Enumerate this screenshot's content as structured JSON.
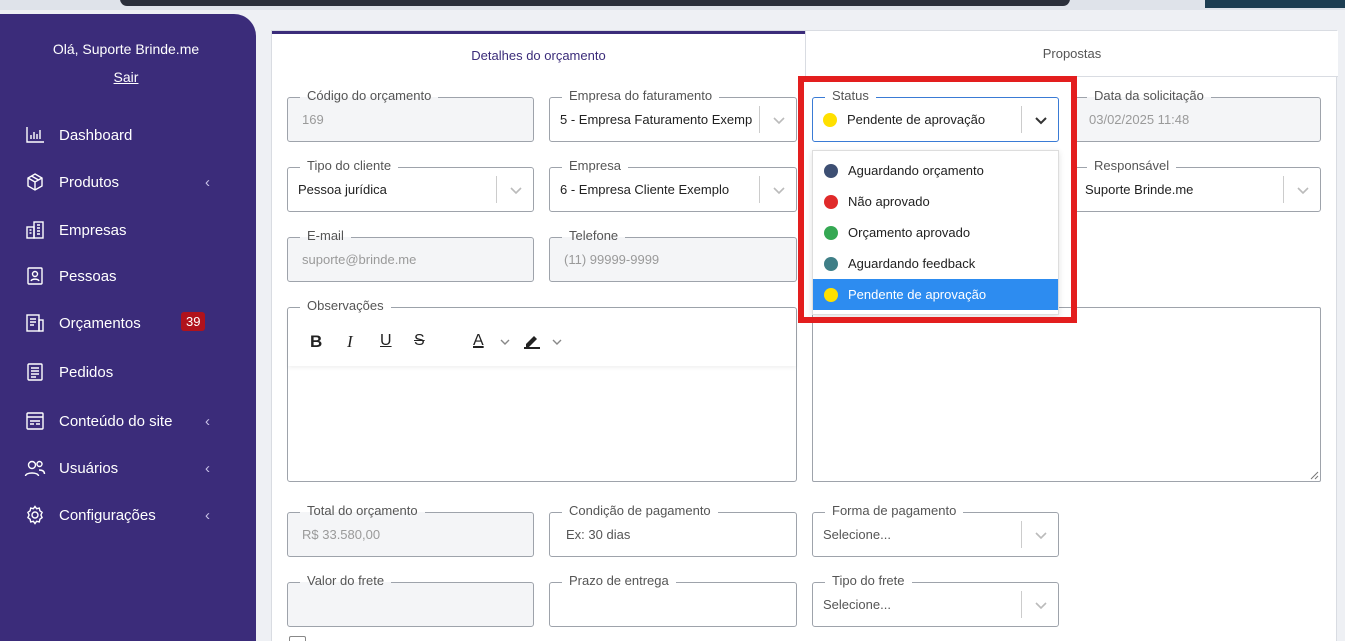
{
  "sidebar": {
    "greeting": "Olá, Suporte Brinde.me",
    "logout": "Sair",
    "items": [
      {
        "label": "Dashboard",
        "icon": "chart-icon"
      },
      {
        "label": "Produtos",
        "icon": "box-icon"
      },
      {
        "label": "Empresas",
        "icon": "building-icon"
      },
      {
        "label": "Pessoas",
        "icon": "person-card-icon"
      },
      {
        "label": "Orçamentos",
        "icon": "document-list-icon",
        "badge": "39"
      },
      {
        "label": "Pedidos",
        "icon": "document-icon"
      },
      {
        "label": "Conteúdo do site",
        "icon": "site-content-icon"
      },
      {
        "label": "Usuários",
        "icon": "users-icon"
      },
      {
        "label": "Configurações",
        "icon": "gear-icon"
      }
    ]
  },
  "tabs": {
    "details": "Detalhes do orçamento",
    "proposals": "Propostas"
  },
  "form": {
    "code": {
      "label": "Código do orçamento",
      "value": "169"
    },
    "billing_company": {
      "label": "Empresa do faturamento",
      "value": "5 - Empresa Faturamento Exemp"
    },
    "status": {
      "label": "Status",
      "value": "Pendente de aprovação"
    },
    "request_date": {
      "label": "Data da solicitação",
      "value": "03/02/2025 11:48"
    },
    "client_type": {
      "label": "Tipo do cliente",
      "value": "Pessoa jurídica"
    },
    "company": {
      "label": "Empresa",
      "value": "6 - Empresa Cliente Exemplo"
    },
    "responsible": {
      "label": "Responsável",
      "value": "Suporte Brinde.me"
    },
    "email": {
      "label": "E-mail",
      "value": "suporte@brinde.me"
    },
    "phone": {
      "label": "Telefone",
      "value": "(11) 99999-9999"
    },
    "notes": {
      "label": "Observações"
    },
    "total": {
      "label": "Total do orçamento",
      "value": "R$ 33.580,00"
    },
    "payment_condition": {
      "label": "Condição de pagamento",
      "placeholder": "Ex: 30 dias"
    },
    "payment_method": {
      "label": "Forma de pagamento",
      "placeholder": "Selecione..."
    },
    "freight_value": {
      "label": "Valor do frete",
      "value": ""
    },
    "delivery_time": {
      "label": "Prazo de entrega",
      "value": ""
    },
    "freight_type": {
      "label": "Tipo do frete",
      "placeholder": "Selecione..."
    }
  },
  "status_options": [
    {
      "label": "Aguardando orçamento",
      "color": "#3d4f73"
    },
    {
      "label": "Não aprovado",
      "color": "#e02a2a"
    },
    {
      "label": "Orçamento aprovado",
      "color": "#35a853"
    },
    {
      "label": "Aguardando feedback",
      "color": "#3f7f87"
    },
    {
      "label": "Pendente de aprovação",
      "color": "#ffe000"
    }
  ],
  "colors": {
    "sidebar_bg": "#3b2c7a",
    "accent": "#3b2c7a",
    "selected_option": "#2d8cf0",
    "highlight_box": "#e31e1e",
    "badge": "#b0121c"
  },
  "editor_toolbar": [
    "bold",
    "italic",
    "underline",
    "strikethrough",
    "text-color",
    "highlight-color"
  ]
}
